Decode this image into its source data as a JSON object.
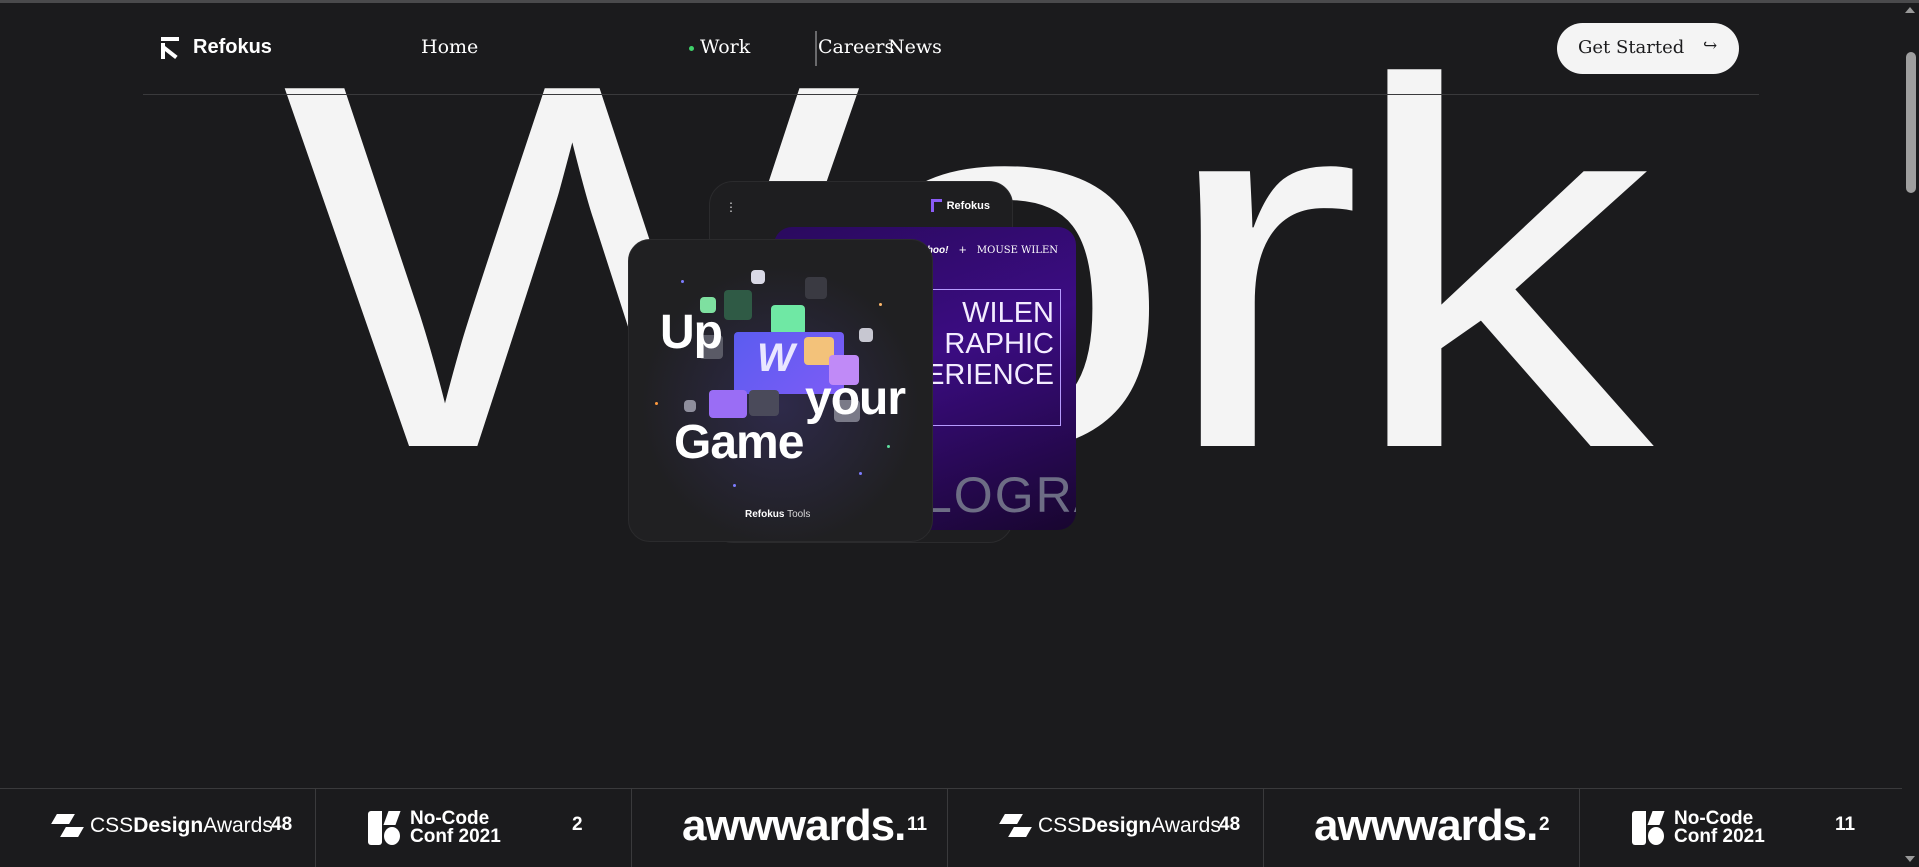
{
  "header": {
    "logo_text": "Refokus",
    "nav": [
      {
        "label": "Home"
      },
      {
        "label": "Work",
        "active": true
      },
      {
        "label": "Careers"
      },
      {
        "label": "News"
      }
    ],
    "cta_label": "Get Started",
    "cta_icon": "arrow-return-right-icon"
  },
  "hero": {
    "title": "Work"
  },
  "cards": {
    "phone_brand": "Refokus",
    "purple": {
      "partner_left": "yahoo!",
      "separator": "+",
      "partner_right": "MOUSE WILEN",
      "lines": [
        "WILEN",
        "RAPHIC",
        "PERIENCE"
      ],
      "bottom_text": "LOGRA"
    },
    "game": {
      "line1": "Up",
      "line2": "your",
      "line3": "Game",
      "badge": "W",
      "footer_brand": "Refokus",
      "footer_label": "Tools"
    }
  },
  "awards": [
    {
      "logo": "cssda",
      "name_light_1": "CSS",
      "name_bold": "Design",
      "name_light_2": "Awards",
      "count": "48"
    },
    {
      "logo": "nocode",
      "line1": "No-Code",
      "line2": "Conf 2021",
      "count": "2"
    },
    {
      "logo": "awwwards",
      "name": "awwwards.",
      "count": "11"
    },
    {
      "logo": "cssda",
      "name_light_1": "CSS",
      "name_bold": "Design",
      "name_light_2": "Awards",
      "count": "48"
    },
    {
      "logo": "awwwards",
      "name": "awwwards.",
      "count": "2"
    },
    {
      "logo": "nocode",
      "line1": "No-Code",
      "line2": "Conf 2021",
      "count": "11"
    }
  ],
  "colors": {
    "background": "#1b1b1d",
    "hero_text": "#f4f4f4",
    "active_dot": "#3fd16a",
    "cta_background": "#f4f4f4",
    "accent_purple": "#8b5cf6"
  }
}
